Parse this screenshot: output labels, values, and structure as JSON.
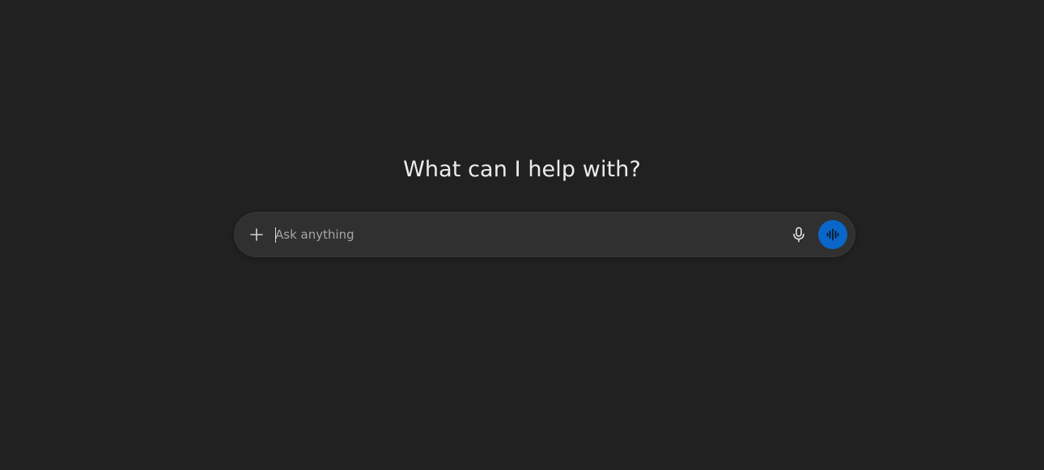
{
  "main": {
    "headline": "What can I help with?"
  },
  "composer": {
    "placeholder": "Ask anything",
    "value": "",
    "plus_icon": "plus-icon",
    "mic_icon": "microphone-icon",
    "voice_icon": "voice-waveform-icon"
  },
  "colors": {
    "background": "#212121",
    "composer_bg": "#303030",
    "accent": "#0a66c8",
    "text": "#ececec",
    "placeholder": "#a6a6a6"
  }
}
